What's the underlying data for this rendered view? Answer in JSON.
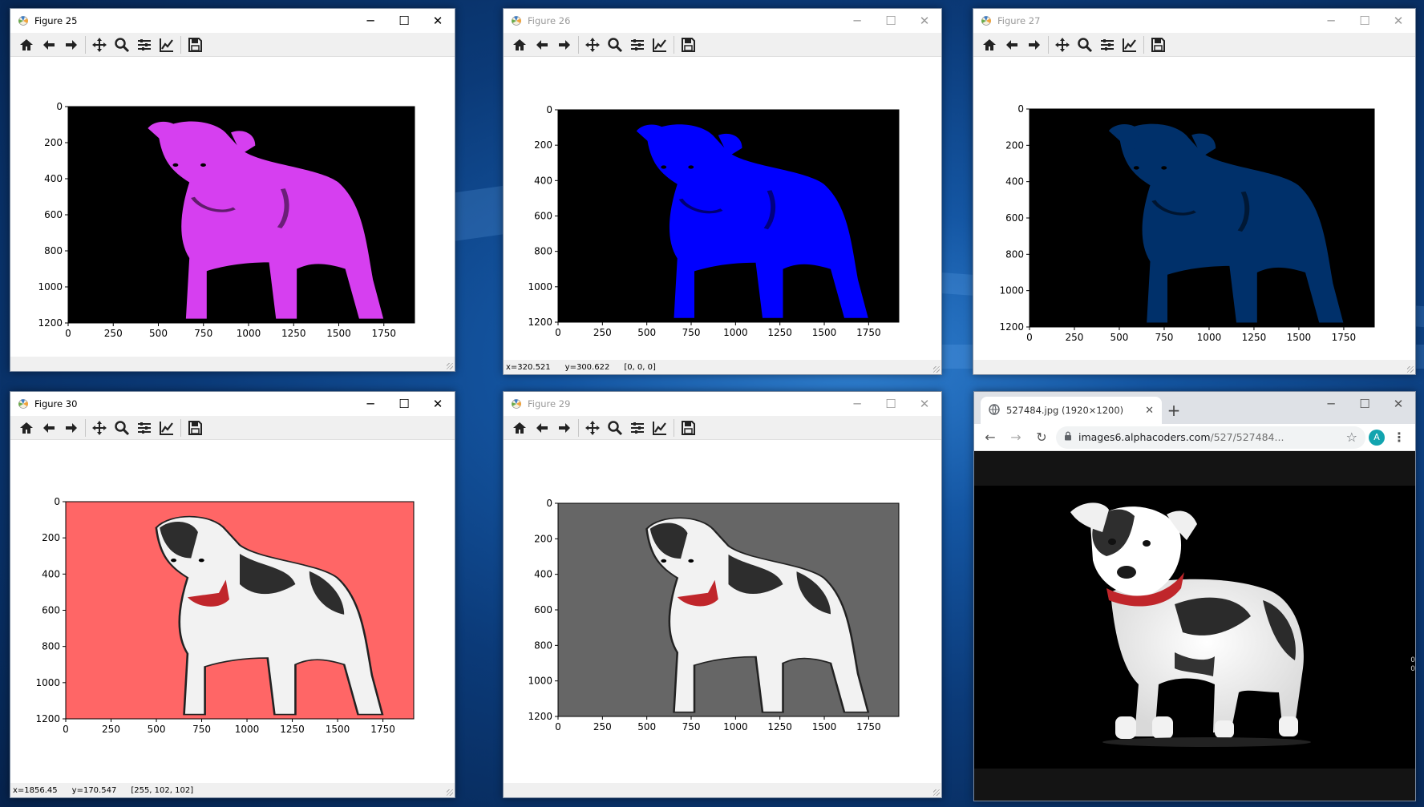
{
  "colors": {
    "magenta_dog": "#d63ff0",
    "blue_dog": "#0000ff",
    "navy_dog": "#00306a",
    "salmon_bg": "#ff6666",
    "gray_bg": "#666666"
  },
  "figures": [
    {
      "id": "fig25",
      "title": "Figure 25",
      "active": true,
      "variant": "magenta",
      "status": null
    },
    {
      "id": "fig26",
      "title": "Figure 26",
      "active": false,
      "variant": "blue",
      "status": {
        "x": "x=320.521",
        "y": "y=300.622",
        "rgb": "[0, 0, 0]"
      }
    },
    {
      "id": "fig27",
      "title": "Figure 27",
      "active": false,
      "variant": "navy",
      "status": null
    },
    {
      "id": "fig30",
      "title": "Figure 30",
      "active": true,
      "variant": "salmon",
      "status": {
        "x": "x=1856.45",
        "y": "y=170.547",
        "rgb": "[255, 102, 102]"
      }
    },
    {
      "id": "fig29",
      "title": "Figure 29",
      "active": false,
      "variant": "gray",
      "status": null
    }
  ],
  "axes": {
    "x_ticks": [
      "0",
      "250",
      "500",
      "750",
      "1000",
      "1250",
      "1500",
      "1750"
    ],
    "y_ticks": [
      "0",
      "200",
      "400",
      "600",
      "800",
      "1000",
      "1200"
    ]
  },
  "toolbar_icons": [
    "home-icon",
    "back-icon",
    "forward-icon",
    "pan-icon",
    "zoom-icon",
    "configure-subplots-icon",
    "edit-axis-icon",
    "save-icon"
  ],
  "browser": {
    "tab_title": "527484.jpg (1920×1200)",
    "url_host": "images6.alphacoders.com",
    "url_path": "/527/527484...",
    "profile_initial": "A",
    "new_tab_label": "+"
  }
}
